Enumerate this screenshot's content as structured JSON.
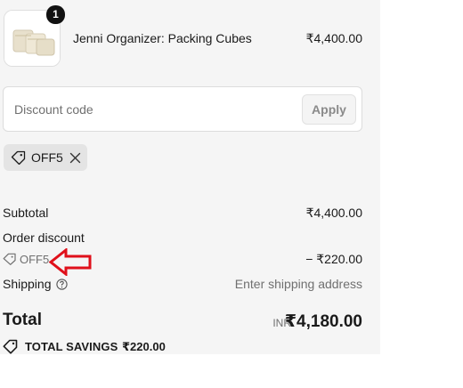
{
  "line_item": {
    "quantity": "1",
    "name": "Jenni Organizer: Packing Cubes",
    "price": "₹4,400.00"
  },
  "discount": {
    "placeholder": "Discount code",
    "apply_label": "Apply",
    "applied_code": "OFF5"
  },
  "summary": {
    "subtotal_label": "Subtotal",
    "subtotal_value": "₹4,400.00",
    "order_discount_label": "Order discount",
    "order_discount_code": "OFF5",
    "order_discount_value": "− ₹220.00",
    "shipping_label": "Shipping",
    "shipping_value": "Enter shipping address",
    "total_label": "Total",
    "currency": "INR",
    "total_value": "₹4,180.00",
    "savings_label": "TOTAL SAVINGS",
    "savings_value": "₹220.00"
  },
  "colors": {
    "annotation_arrow": "#e0101a",
    "panel_background": "#f5f5f5"
  },
  "icons": [
    "product-thumbnail",
    "tag-icon",
    "close-icon",
    "help-icon",
    "red-arrow-annotation"
  ]
}
